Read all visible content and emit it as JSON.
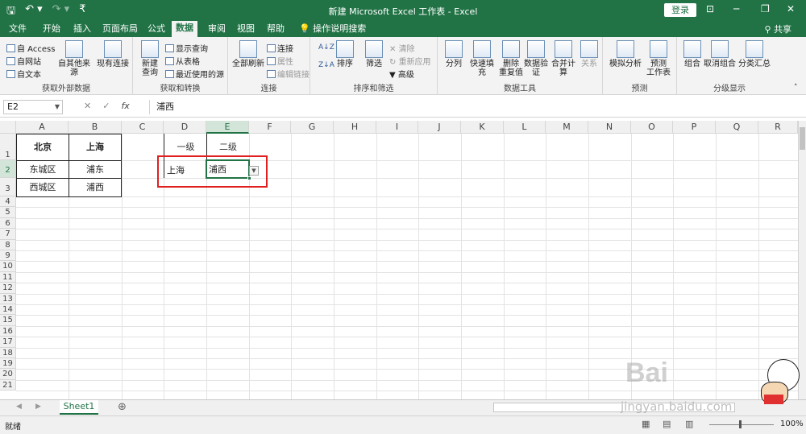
{
  "titlebar": {
    "title": "新建 Microsoft Excel 工作表  -  Excel",
    "login": "登录",
    "qat": [
      "🖫",
      "↶ ▾",
      "↷ ▾",
      "₹"
    ]
  },
  "tabs": [
    "文件",
    "开始",
    "插入",
    "页面布局",
    "公式",
    "数据",
    "审阅",
    "视图",
    "帮助",
    "操作说明搜索"
  ],
  "active_tab": "数据",
  "share": "共享",
  "ribbon": {
    "groups": {
      "external": "获取外部数据",
      "transform": "获取和转换",
      "connections": "连接",
      "sortfilter": "排序和筛选",
      "datatools": "数据工具",
      "forecast": "预测",
      "outline": "分级显示"
    },
    "access": "自 Access",
    "web": "自网站",
    "text": "自文本",
    "other_sources": "自其他来源",
    "existing_conn": "现有连接",
    "new_query": "新建\n查询",
    "show_queries": "显示查询",
    "from_table": "从表格",
    "recent_sources": "最近使用的源",
    "refresh_all": "全部刷新",
    "connections": "连接",
    "properties": "属性",
    "edit_links": "编辑链接",
    "sort": "排序",
    "filter": "筛选",
    "clear": "清除",
    "reapply": "重新应用",
    "advanced": "高级",
    "text_to_columns": "分列",
    "flash_fill": "快速填充",
    "remove_dupes": "删除\n重复值",
    "data_validation": "数据验\n证",
    "consolidate": "合并计算",
    "relationships": "关系",
    "whatif": "模拟分析",
    "forecast_sheet": "预测\n工作表",
    "group": "组合",
    "ungroup": "取消组合",
    "subtotal": "分类汇总"
  },
  "formula_bar": {
    "name_box": "E2",
    "formula": "浦西",
    "fx": "fx",
    "cancel": "✕",
    "enter": "✓"
  },
  "columns": [
    "A",
    "B",
    "C",
    "D",
    "E",
    "F",
    "G",
    "H",
    "I",
    "J",
    "K",
    "L",
    "M",
    "N",
    "O",
    "P",
    "Q",
    "R"
  ],
  "rows": [
    "1",
    "2",
    "3",
    "4",
    "5",
    "6",
    "7",
    "8",
    "9",
    "10",
    "11",
    "12",
    "13",
    "14",
    "15",
    "16",
    "17",
    "18",
    "19",
    "20",
    "21"
  ],
  "cells": {
    "A1": "北京",
    "B1": "上海",
    "A2": "东城区",
    "B2": "浦东",
    "A3": "西城区",
    "B3": "浦西",
    "D1": "一级",
    "E1": "二级",
    "D2": "上海",
    "E2": "浦西"
  },
  "sheet": {
    "tab": "Sheet1",
    "add": "⊕"
  },
  "status": {
    "ready": "就绪",
    "zoom": "100%"
  },
  "watermark": {
    "brand": "Bai",
    "site": "jingyan.baidu.com"
  },
  "colors": {
    "excel_green": "#217346",
    "highlight_red": "#e02020"
  }
}
